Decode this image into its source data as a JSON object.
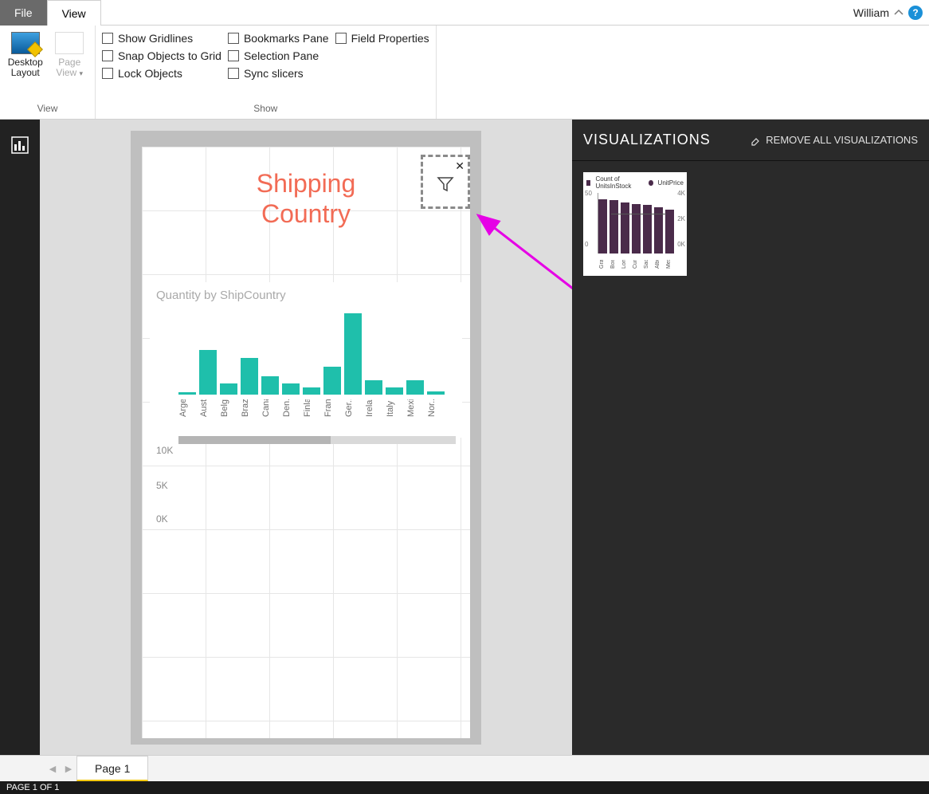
{
  "tabs": {
    "file": "File",
    "view": "View"
  },
  "user": "William",
  "ribbon": {
    "view": {
      "desktop_layout": "Desktop\nLayout",
      "page_view": "Page\nView",
      "group_label": "View"
    },
    "show_checks_col1": [
      {
        "label": "Show Gridlines"
      },
      {
        "label": "Snap Objects to Grid"
      },
      {
        "label": "Lock Objects"
      }
    ],
    "show_checks_col2": [
      {
        "label": "Bookmarks Pane"
      },
      {
        "label": "Selection Pane"
      },
      {
        "label": "Sync slicers"
      }
    ],
    "show_checks_col3": [
      {
        "label": "Field Properties"
      }
    ],
    "show_label": "Show"
  },
  "canvas": {
    "title": "Shipping\nCountry"
  },
  "chart_data": {
    "type": "bar",
    "title": "Quantity by ShipCountry",
    "ylabel": "",
    "yticks": [
      "10K",
      "5K",
      "0K"
    ],
    "ylim": [
      0,
      10000
    ],
    "categories": [
      "Arge...",
      "Austria",
      "Belgi...",
      "Brazil",
      "Cana...",
      "Den...",
      "Finla...",
      "France",
      "Ger...",
      "Ireland",
      "Italy",
      "Mexi...",
      "Nor..."
    ],
    "values": [
      300,
      5100,
      1300,
      4200,
      2100,
      1300,
      800,
      3200,
      9300,
      1600,
      800,
      1600,
      400
    ]
  },
  "viz_panel": {
    "title": "VISUALIZATIONS",
    "remove": "REMOVE ALL VISUALIZATIONS",
    "thumb": {
      "legend1": "Count of UnitsInStock",
      "legend2": "UnitPrice",
      "ylticks": [
        "50",
        "0"
      ],
      "yrticks": [
        "4K",
        "2K",
        "0K"
      ],
      "categories": [
        "Graz",
        "Boise",
        "London",
        "Cunewa...",
        "Sao Pau...",
        "Albuqu...",
        "Mexico ..."
      ],
      "values": [
        45,
        44,
        42,
        41,
        40,
        38,
        36
      ]
    }
  },
  "page_tabs": {
    "page1": "Page 1"
  },
  "status": "PAGE 1 OF 1"
}
